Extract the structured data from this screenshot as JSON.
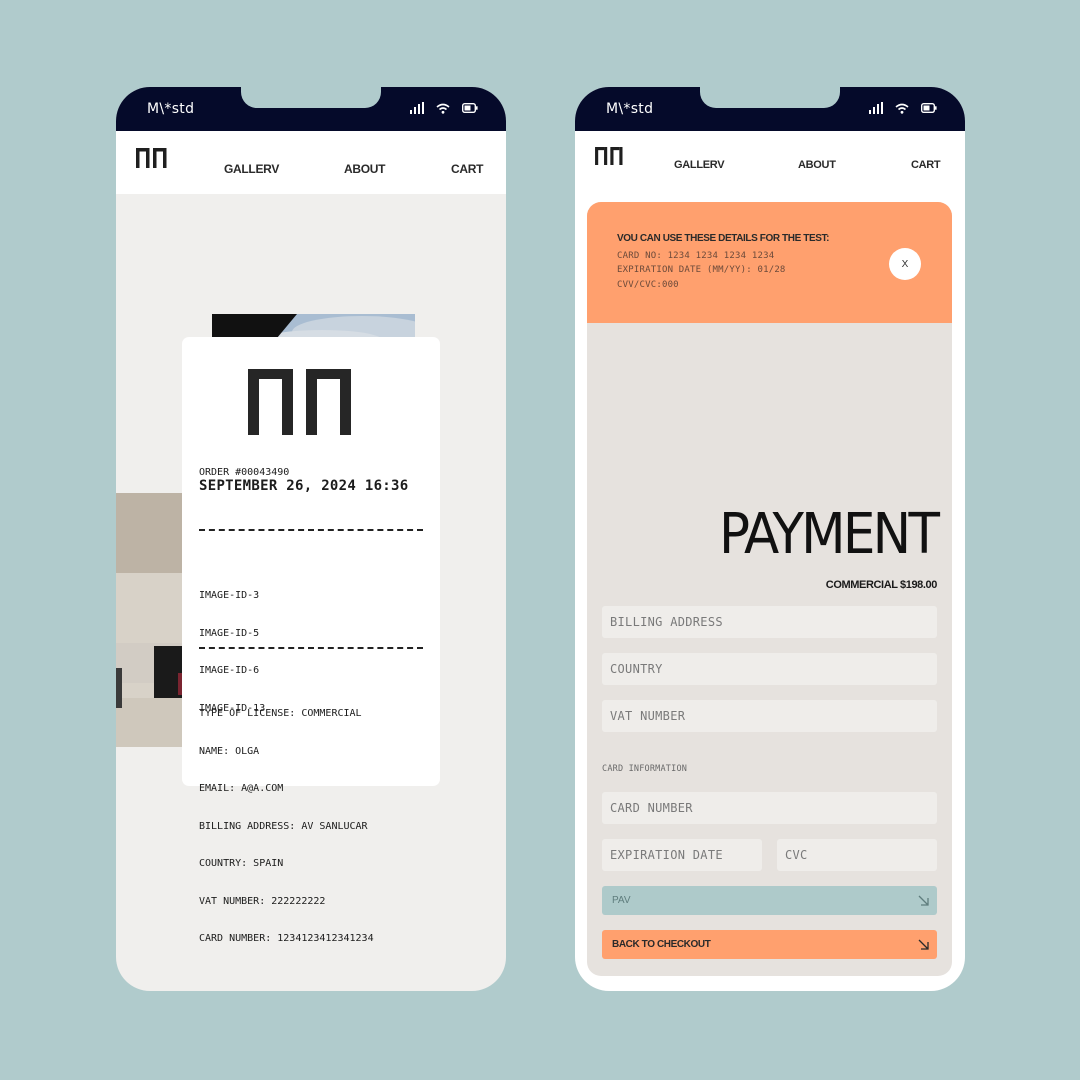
{
  "status_bar": {
    "carrier": "M\\*std"
  },
  "nav": {
    "logo": "NN",
    "links": {
      "gallery": "GALLERV",
      "about": "ABOUT",
      "cart": "CART"
    }
  },
  "receipt": {
    "order_number": "ORDER #00043490",
    "date": "SEPTEMBER 26, 2024 16:36",
    "images": [
      "IMAGE-ID-3",
      "IMAGE-ID-5",
      "IMAGE-ID-6",
      "IMAGE-ID-13"
    ],
    "details": [
      "TYPE OF LICENSE: COMMERCIAL",
      "NAME: OLGA",
      "EMAIL: A@A.COM",
      "BILLING ADDRESS: AV SANLUCAR",
      "COUNTRY: SPAIN",
      "VAT NUMBER: 222222222",
      "CARD NUMBER: 1234123412341234"
    ]
  },
  "banner": {
    "title": "VOU CAN USE THESE DETAILS FOR THE TEST:",
    "card_no": "CARD NO: 1234 1234 1234 1234",
    "expiration": "EXPIRATION DATE (MM/YY): 01/28",
    "cvv": "CVV/CVC:000",
    "close_label": "X"
  },
  "payment": {
    "title": "PAYMENT",
    "price": "COMMERCIAL $198.00",
    "billing_placeholder": "BILLING ADDRESS",
    "country_placeholder": "COUNTRY",
    "vat_placeholder": "VAT NUMBER",
    "card_info_label": "CARD INFORMATION",
    "card_number_placeholder": "CARD NUMBER",
    "expiration_placeholder": "EXPIRATION DATE",
    "cvc_placeholder": "CVC",
    "pay_label": "PAV",
    "back_label": "BACK TO CHECKOUT"
  },
  "colors": {
    "status_bar": "#050a2a",
    "accent_orange": "#ffa06e",
    "pay_button": "#aecaca",
    "background": "#b0cbcc"
  }
}
